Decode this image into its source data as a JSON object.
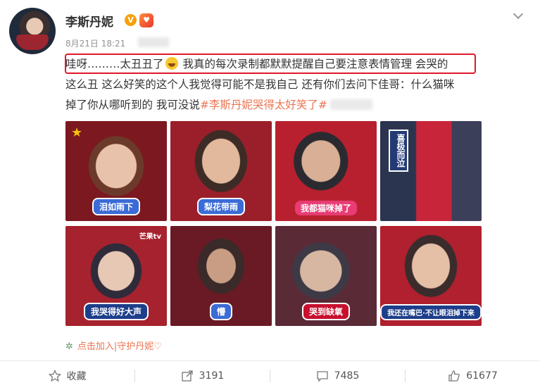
{
  "post": {
    "author": "李斯丹妮",
    "verified_badge": "V",
    "date": "8月21日 18:21",
    "text_line1_pre": "哇呀………太丑丑了",
    "text_line1_post": " 我真的每次录制都默默提醒自己要注意表情管理 会哭的",
    "text_line2": "这么丑 这么好笑的这个人我觉得可能不是我自己 还有你们去问下佳哥：什么猫咪",
    "text_line3_pre": "掉了你从哪听到的 我可没说",
    "topic": "#李斯丹妮哭得太好笑了#",
    "highlight_color": "#e0182a",
    "topic_color": "#eb7350"
  },
  "images": [
    {
      "caption": "泪如雨下",
      "style": "blue",
      "star": "★"
    },
    {
      "caption": "梨花带雨",
      "style": "blue"
    },
    {
      "caption": "我都猫咪掉了",
      "style": "pink"
    },
    {
      "caption": "喜极而泣",
      "style": "vertical"
    },
    {
      "caption": "我哭得好大声",
      "style": "dark",
      "logo": "芒果tv"
    },
    {
      "caption": "懵",
      "style": "blue"
    },
    {
      "caption": "哭到缺氧",
      "style": "red"
    },
    {
      "caption": "我还在嘴巴·不让眼泪掉下来",
      "style": "dark"
    }
  ],
  "supertopic": {
    "label": "点击加入|守护丹妮♡",
    "icon": "gear-icon"
  },
  "actions": {
    "favorite": "收藏",
    "repost_count": "3191",
    "comment_count": "7485",
    "like_count": "61677"
  }
}
